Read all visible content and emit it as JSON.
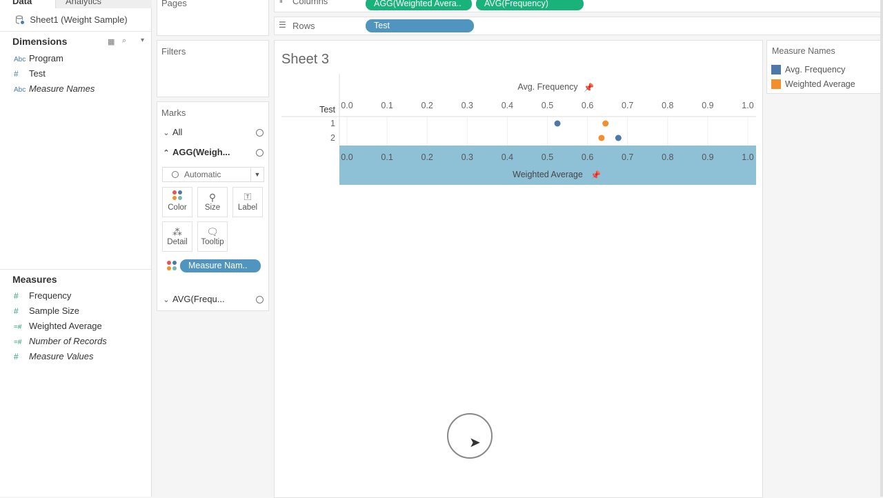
{
  "tabs": {
    "data": "Data",
    "analytics": "Analytics"
  },
  "datasource": {
    "name": "Sheet1 (Weight Sample)"
  },
  "dimensions": {
    "title": "Dimensions",
    "items": [
      {
        "label": "Program",
        "type": "Abc"
      },
      {
        "label": "Test",
        "type": "#"
      },
      {
        "label": "Measure Names",
        "type": "Abc"
      }
    ]
  },
  "measures": {
    "title": "Measures",
    "items": [
      {
        "label": "Frequency",
        "type": "#"
      },
      {
        "label": "Sample Size",
        "type": "#"
      },
      {
        "label": "Weighted Average",
        "type": "=#"
      },
      {
        "label": "Number of Records",
        "type": "=#"
      },
      {
        "label": "Measure Values",
        "type": "#"
      }
    ]
  },
  "shelves": {
    "pages": "Pages",
    "filters": "Filters",
    "columns_label": "Columns",
    "rows_label": "Rows",
    "columns_pills": [
      "AGG(Weighted Avera..",
      "AVG(Frequency)"
    ],
    "rows_pill": "Test"
  },
  "marks": {
    "title": "Marks",
    "all": "All",
    "agg": "AGG(Weigh...",
    "avg": "AVG(Frequ...",
    "mark_type": "Automatic",
    "buttons": {
      "color": "Color",
      "size": "Size",
      "label": "Label",
      "detail": "Detail",
      "tooltip": "Tooltip"
    },
    "pill": "Measure Nam.."
  },
  "sheet": {
    "title": "Sheet 3"
  },
  "legend": {
    "title": "Measure Names",
    "items": [
      {
        "label": "Avg. Frequency",
        "color": "#4e79a7"
      },
      {
        "label": "Weighted Average",
        "color": "#f28e2b"
      }
    ]
  },
  "chart_data": {
    "type": "scatter",
    "row_header": "Test",
    "rows": [
      "1",
      "2"
    ],
    "top_axis_title": "Avg. Frequency",
    "bottom_axis_title": "Weighted Average",
    "xlim": [
      0,
      1
    ],
    "ticks": [
      "0.0",
      "0.1",
      "0.2",
      "0.3",
      "0.4",
      "0.5",
      "0.6",
      "0.7",
      "0.8",
      "0.9",
      "1.0"
    ],
    "series": [
      {
        "name": "Avg. Frequency",
        "color": "#4e79a7",
        "values": [
          0.525,
          0.677
        ]
      },
      {
        "name": "Weighted Average",
        "color": "#f28e2b",
        "values": [
          0.645,
          0.635
        ]
      }
    ]
  }
}
